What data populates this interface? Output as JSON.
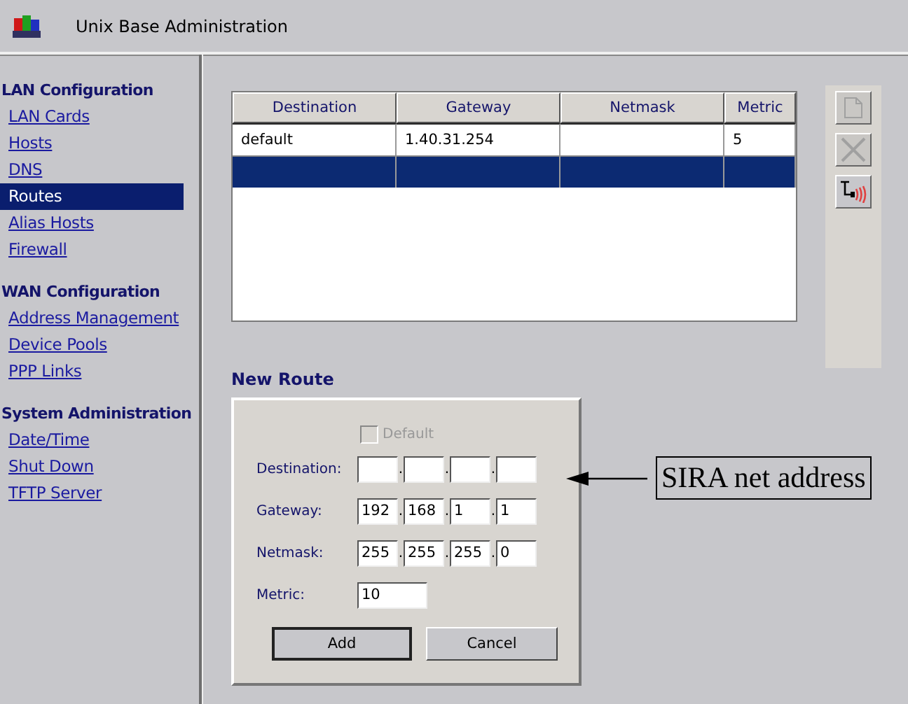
{
  "window": {
    "title": "Unix Base Administration"
  },
  "sidebar": {
    "sections": [
      {
        "heading": "LAN Configuration",
        "items": [
          {
            "label": "LAN Cards",
            "selected": false
          },
          {
            "label": "Hosts",
            "selected": false
          },
          {
            "label": "DNS",
            "selected": false
          },
          {
            "label": "Routes",
            "selected": true
          },
          {
            "label": "Alias Hosts",
            "selected": false
          },
          {
            "label": "Firewall",
            "selected": false
          }
        ]
      },
      {
        "heading": "WAN Configuration",
        "items": [
          {
            "label": "Address Management",
            "selected": false
          },
          {
            "label": "Device Pools",
            "selected": false
          },
          {
            "label": "PPP Links",
            "selected": false
          }
        ]
      },
      {
        "heading": "System Administration",
        "items": [
          {
            "label": "Date/Time",
            "selected": false
          },
          {
            "label": "Shut Down",
            "selected": false
          },
          {
            "label": "TFTP Server",
            "selected": false
          }
        ]
      }
    ]
  },
  "routes_table": {
    "columns": [
      "Destination",
      "Gateway",
      "Netmask",
      "Metric"
    ],
    "rows": [
      {
        "cells": [
          "default",
          "1.40.31.254",
          null,
          "5"
        ],
        "selected": false
      },
      {
        "cells": [
          null,
          null,
          null,
          null
        ],
        "selected": true
      }
    ]
  },
  "toolbar": [
    {
      "kind": "new",
      "disabled": true
    },
    {
      "kind": "delete",
      "disabled": true
    },
    {
      "kind": "ping",
      "disabled": false
    }
  ],
  "new_route": {
    "title": "New Route",
    "default_checkbox": {
      "label": "Default",
      "checked": false,
      "disabled": true
    },
    "octet_separator": ".",
    "fields": [
      {
        "label": "Destination:",
        "kind": "ip"
      },
      {
        "label": "Gateway:",
        "kind": "ip",
        "octets": [
          "192",
          "168",
          "1",
          "1"
        ]
      },
      {
        "label": "Netmask:",
        "kind": "ip",
        "octets": [
          "255",
          "255",
          "255",
          "0"
        ]
      },
      {
        "label": "Metric:",
        "kind": "text",
        "value": "10"
      }
    ],
    "buttons": [
      "Add",
      "Cancel"
    ]
  },
  "annotation": {
    "label": "SIRA net address"
  }
}
